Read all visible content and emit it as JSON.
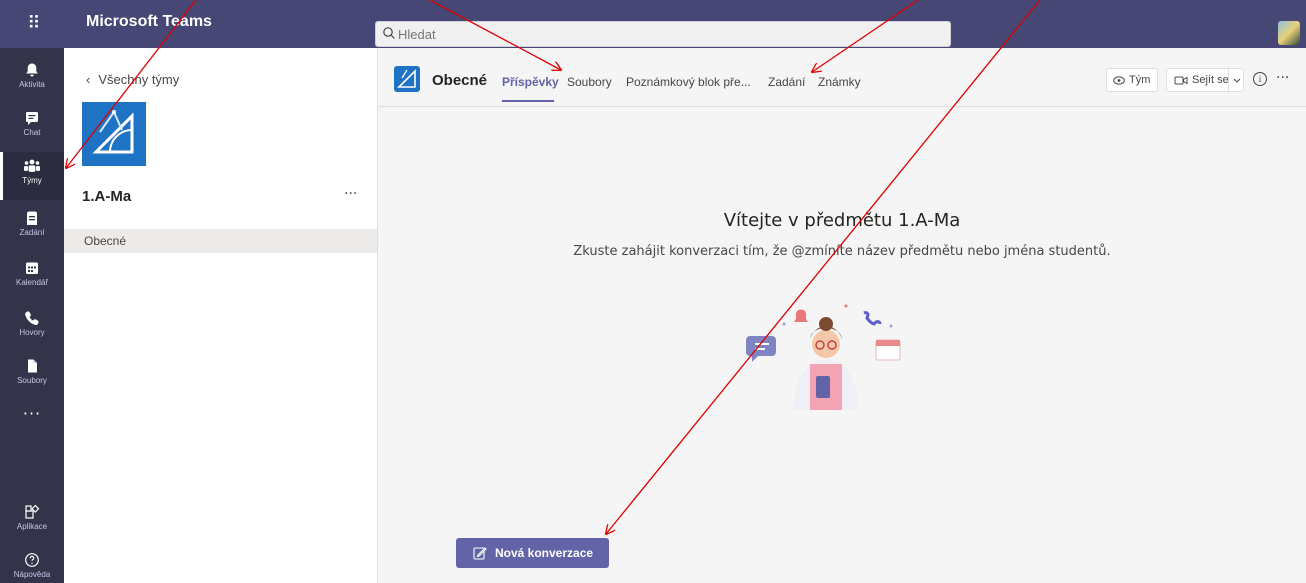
{
  "titlebar": {
    "app_name": "Microsoft Teams",
    "search_placeholder": "Hledat"
  },
  "rail": {
    "items": [
      {
        "label": "Aktivita",
        "icon": "bell-icon"
      },
      {
        "label": "Chat",
        "icon": "chat-icon"
      },
      {
        "label": "Týmy",
        "icon": "teams-icon"
      },
      {
        "label": "Zadání",
        "icon": "assignments-icon"
      },
      {
        "label": "Kalendář",
        "icon": "calendar-icon"
      },
      {
        "label": "Hovory",
        "icon": "phone-icon"
      },
      {
        "label": "Soubory",
        "icon": "file-icon"
      }
    ],
    "more": "···",
    "bottom": [
      {
        "label": "Aplikace",
        "icon": "apps-icon"
      },
      {
        "label": "Nápověda",
        "icon": "help-icon"
      }
    ],
    "active_index": 2
  },
  "teampanel": {
    "back_label": "Všechny týmy",
    "team_name": "1.A-Ma",
    "team_more": "···",
    "channels": [
      "Obecné"
    ]
  },
  "main": {
    "channel_name": "Obecné",
    "tabs": [
      "Příspěvky",
      "Soubory",
      "Poznámkový blok pře...",
      "Zadání",
      "Známky"
    ],
    "active_tab": "Příspěvky",
    "team_button": "Tým",
    "meet_button": "Sejít se",
    "info_icon": "i",
    "more": "···",
    "welcome_title": "Vítejte v předmětu 1.A-Ma",
    "welcome_subtitle": "Zkuste zahájit konverzaci tím, že @zmíníte název předmětu nebo jména studentů.",
    "new_conversation": "Nová konverzace"
  },
  "colors": {
    "titlebar": "#464775",
    "rail": "#33344a",
    "accent": "#6264a7",
    "annotation": "#e00000"
  }
}
